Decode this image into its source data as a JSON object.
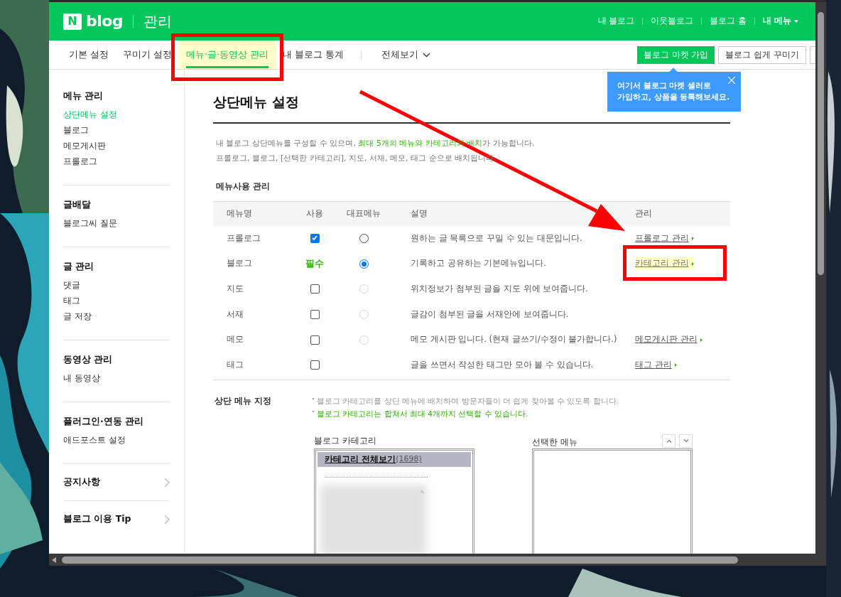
{
  "header": {
    "logo_mark": "N",
    "logo_text": "blog",
    "title": "관리",
    "links": [
      {
        "label": "내 블로그",
        "bold": false,
        "dropdown": false
      },
      {
        "label": "이웃블로그",
        "bold": false,
        "dropdown": false
      },
      {
        "label": "블로그 홈",
        "bold": false,
        "dropdown": false
      },
      {
        "label": "내 메뉴",
        "bold": true,
        "dropdown": true
      }
    ]
  },
  "nav": {
    "tabs": [
      {
        "label": "기본 설정",
        "selected": false,
        "highlighted": false
      },
      {
        "label": "꾸미기 설정",
        "selected": false,
        "highlighted": false
      },
      {
        "label": "메뉴·글·동영상 관리",
        "selected": true,
        "highlighted": true
      },
      {
        "label": "내 블로그 통계",
        "selected": false,
        "highlighted": false
      }
    ],
    "view_all": "전체보기",
    "buttons": [
      {
        "label": "블로그 마켓 가입",
        "kind": "primary"
      },
      {
        "label": "블로그 쉽게 꾸미기",
        "kind": "outline"
      }
    ]
  },
  "tooltip": {
    "lines": [
      "여기서 블로그 마켓 셀러로",
      "가입하고, 상품을 등록해보세요."
    ]
  },
  "sidebar": [
    {
      "title": "메뉴 관리",
      "kind": "group",
      "items": [
        {
          "label": "상단메뉴 설정",
          "selected": true
        },
        {
          "label": "블로그",
          "selected": false
        },
        {
          "label": "메모게시판",
          "selected": false
        },
        {
          "label": "프롤로그",
          "selected": false
        }
      ]
    },
    {
      "title": "글배달",
      "kind": "group",
      "items": [
        {
          "label": "블로그씨 질문",
          "selected": false
        }
      ]
    },
    {
      "title": "글 관리",
      "kind": "group",
      "items": [
        {
          "label": "댓글",
          "selected": false
        },
        {
          "label": "태그",
          "selected": false
        },
        {
          "label": "글 저장",
          "selected": false
        }
      ]
    },
    {
      "title": "동영상 관리",
      "kind": "group",
      "items": [
        {
          "label": "내 동영상",
          "selected": false
        }
      ]
    },
    {
      "title": "플러그인·연동 관리",
      "kind": "group",
      "items": [
        {
          "label": "애드포스트 설정",
          "selected": false
        }
      ]
    },
    {
      "title": "공지사항",
      "kind": "link"
    },
    {
      "title": "블로그 이용 Tip",
      "kind": "link"
    }
  ],
  "content": {
    "title": "상단메뉴 설정",
    "description": [
      [
        {
          "text": "내 블로그 상단메뉴를 구성할 수 있으며, ",
          "highlight": false
        },
        {
          "text": "최대 5개의 메뉴와 카테고리의 배치",
          "highlight": true
        },
        {
          "text": "가 가능합니다.",
          "highlight": false
        }
      ],
      [
        {
          "text": "프롤로그, 블로그, [선택한 카테고리], 지도, 서재, 메모, 태그 순으로 배치됩니다.",
          "highlight": false
        }
      ]
    ],
    "table": {
      "heading": "메뉴사용 관리",
      "columns": [
        "메뉴명",
        "사용",
        "대표메뉴",
        "설명",
        "관리"
      ],
      "rows": [
        {
          "name": "프롤로그",
          "use": {
            "kind": "checkbox",
            "checked": true
          },
          "main": {
            "kind": "radio",
            "selected": false,
            "disabled": false
          },
          "description": "원하는 글 목록으로 꾸밀 수 있는 대문입니다.",
          "link": {
            "label": "프롤로그 관리",
            "highlighted": false
          }
        },
        {
          "name": "블로그",
          "use": {
            "kind": "required",
            "label": "필수"
          },
          "main": {
            "kind": "radio",
            "selected": true,
            "disabled": false
          },
          "description": "기록하고 공유하는 기본메뉴입니다.",
          "link": {
            "label": "카테고리 관리",
            "highlighted": true
          }
        },
        {
          "name": "지도",
          "use": {
            "kind": "checkbox",
            "checked": false
          },
          "main": {
            "kind": "radio",
            "selected": false,
            "disabled": true
          },
          "description": "위치정보가 첨부된 글을 지도 위에 보여줍니다."
        },
        {
          "name": "서재",
          "use": {
            "kind": "checkbox",
            "checked": false
          },
          "main": {
            "kind": "radio",
            "selected": false,
            "disabled": true
          },
          "description": "글감이 첨부된 글을 서재안에 보여줍니다."
        },
        {
          "name": "메모",
          "use": {
            "kind": "checkbox",
            "checked": false
          },
          "main": {
            "kind": "radio",
            "selected": false,
            "disabled": true
          },
          "description": "메모 게시판 입니다. (현재 글쓰기/수정이 불가합니다.)",
          "link": {
            "label": "메모게시판 관리",
            "highlighted": false
          }
        },
        {
          "name": "태그",
          "use": {
            "kind": "checkbox",
            "checked": false
          },
          "main": {
            "kind": "none"
          },
          "description": "글을 쓰면서 작성한 태그만 모아 볼 수 있습니다.",
          "link": {
            "label": "태그 관리",
            "highlighted": false
          }
        }
      ]
    },
    "top_menu": {
      "heading": "상단 메뉴 지정",
      "notes": [
        {
          "text": "블로그 카테고리를 상단 메뉴에 배치하여 방문자들이 더 쉽게 찾아볼 수 있도록 합니다.",
          "highlight": false
        },
        {
          "text": "블로그 카테고리는 합쳐서 최대 4개까지 선택할 수 있습니다.",
          "highlight": true
        }
      ],
      "category_label": "블로그 카테고리",
      "category_all": "카테고리 전체보기",
      "category_count": "(1698)",
      "selected_label": "선택한 메뉴"
    }
  }
}
